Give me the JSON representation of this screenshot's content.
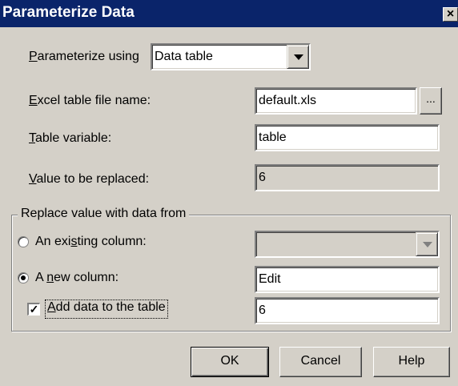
{
  "window": {
    "title": "Parameterize Data",
    "close_label": "×"
  },
  "param_using": {
    "label_accel": "P",
    "label_rest": "arameterize using",
    "selected": "Data table"
  },
  "excel_file": {
    "label_accel": "E",
    "label_rest": "xcel table file name:",
    "value": "default.xls",
    "browse_label": "..."
  },
  "table_var": {
    "label_accel": "T",
    "label_rest": "able variable:",
    "value": "table"
  },
  "value_replaced": {
    "label_accel": "V",
    "label_rest": "alue to be replaced:",
    "value": "6"
  },
  "replace_group": {
    "title": "Replace value with data from",
    "existing_column": {
      "label_pre": "An exi",
      "label_accel": "s",
      "label_post": "ting column:",
      "checked": false,
      "value": ""
    },
    "new_column": {
      "label_pre": "A ",
      "label_accel": "n",
      "label_post": "ew column:",
      "checked": true,
      "value": "Edit"
    },
    "add_data": {
      "label_accel": "A",
      "label_rest": "dd data to the table",
      "checked": true,
      "value": "6"
    }
  },
  "buttons": {
    "ok": "OK",
    "cancel": "Cancel",
    "help": "Help"
  }
}
